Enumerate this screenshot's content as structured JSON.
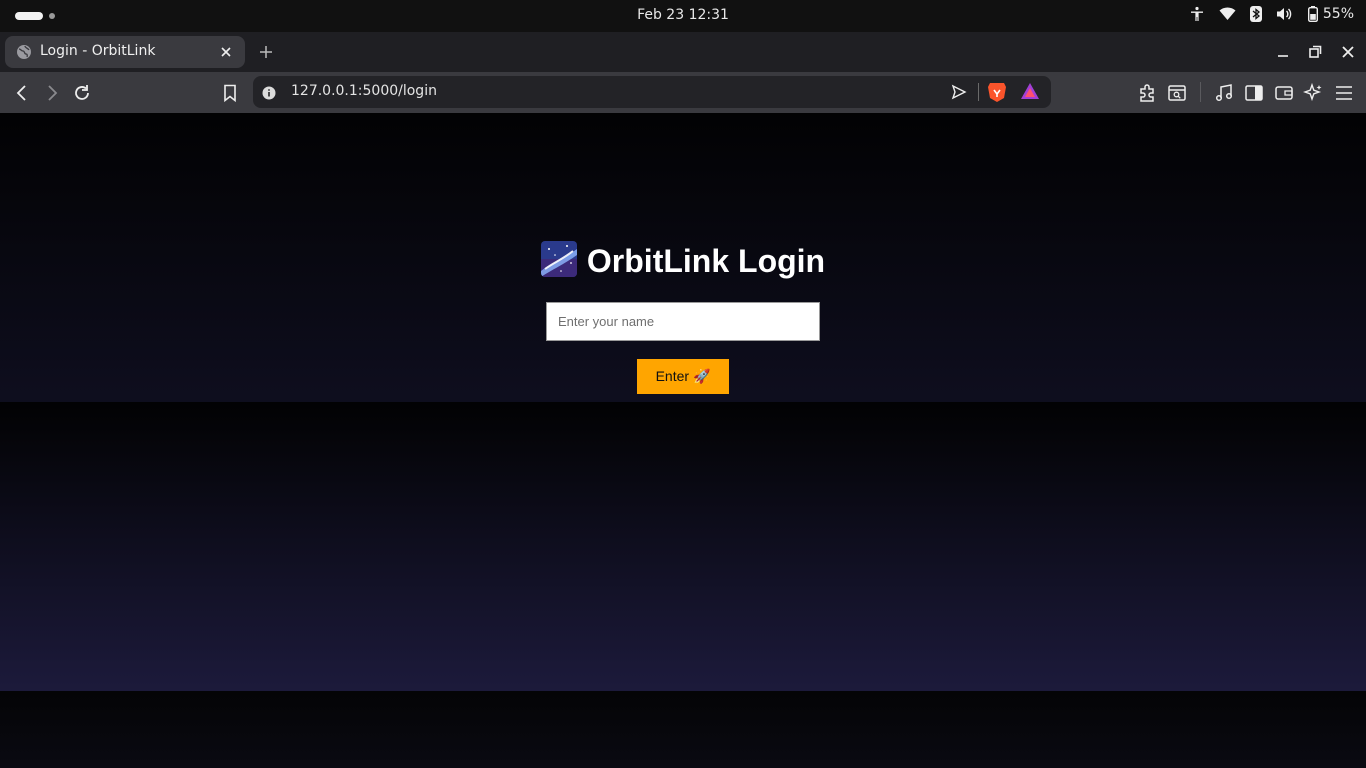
{
  "system_bar": {
    "clock": "Feb 23  12:31",
    "battery_percent": "55%"
  },
  "browser": {
    "tab": {
      "title": "Login - OrbitLink"
    },
    "address_bar": {
      "url": "127.0.0.1:5000/login"
    }
  },
  "page": {
    "heading_text": "OrbitLink Login",
    "name_input": {
      "placeholder": "Enter your name",
      "value": ""
    },
    "enter_button_label": "Enter 🚀",
    "colors": {
      "accent_button": "#ffa500",
      "background_top": "#020203",
      "background_bottom": "#1b1a3a"
    }
  }
}
